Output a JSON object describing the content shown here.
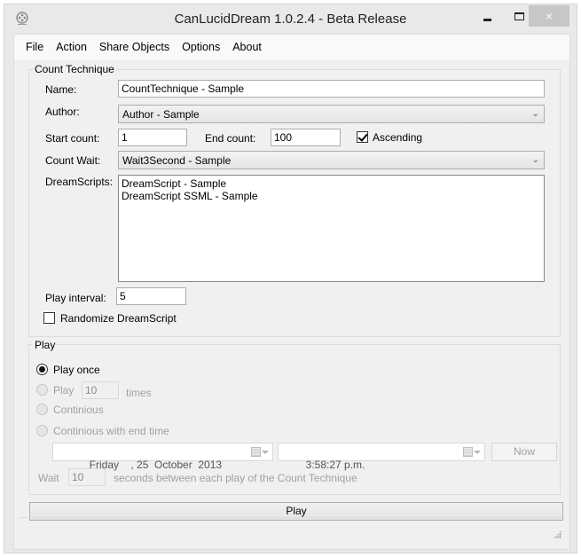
{
  "window": {
    "title": "CanLucidDream 1.0.2.4 - Beta Release",
    "icon": "film-reel-icon",
    "controls": {
      "minimize": "minimize-icon",
      "maximize": "maximize-icon",
      "close": "×"
    }
  },
  "menu": [
    {
      "label": "File"
    },
    {
      "label": "Action"
    },
    {
      "label": "Share Objects"
    },
    {
      "label": "Options"
    },
    {
      "label": "About"
    }
  ],
  "count_technique": {
    "group_label": "Count Technique",
    "name_label": "Name:",
    "name_value": "CountTechnique - Sample",
    "author_label": "Author:",
    "author_value": "Author - Sample",
    "start_count_label": "Start count:",
    "start_count_value": "1",
    "end_count_label": "End count:",
    "end_count_value": "100",
    "ascending_label": "Ascending",
    "ascending_checked": true,
    "count_wait_label": "Count Wait:",
    "count_wait_value": "Wait3Second - Sample",
    "dreamscripts_label": "DreamScripts:",
    "dreamscripts": [
      "DreamScript - Sample",
      "DreamScript SSML - Sample"
    ],
    "play_interval_label": "Play interval:",
    "play_interval_value": "5",
    "randomize_label": "Randomize DreamScript",
    "randomize_checked": false
  },
  "play": {
    "group_label": "Play",
    "options": [
      {
        "label": "Play once",
        "checked": true,
        "enabled": true
      },
      {
        "label": "Play",
        "checked": false,
        "enabled": false
      },
      {
        "label": "Continious",
        "checked": false,
        "enabled": false
      },
      {
        "label": "Continious with end time",
        "checked": false,
        "enabled": false
      }
    ],
    "times_value": "10",
    "times_label": "times",
    "end_date": "Friday    , 25  October  2013",
    "end_time": "3:58:27 p.m.",
    "now_label": "Now",
    "wait_label": "Wait",
    "wait_value": "10",
    "wait_suffix": "seconds between each play of the Count Technique",
    "play_button": "Play"
  }
}
